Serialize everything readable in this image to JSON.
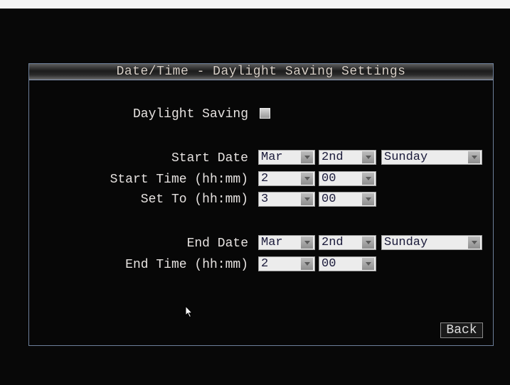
{
  "dialog": {
    "title": "Date/Time - Daylight Saving Settings"
  },
  "daylight_saving": {
    "label": "Daylight Saving",
    "checked": false
  },
  "start": {
    "date_label": "Start Date",
    "month": "Mar",
    "week": "2nd",
    "day": "Sunday",
    "time_label": "Start Time (hh:mm)",
    "hour": "2",
    "minute": "00",
    "setto_label": "Set To (hh:mm)",
    "setto_hour": "3",
    "setto_minute": "00"
  },
  "end": {
    "date_label": "End Date",
    "month": "Mar",
    "week": "2nd",
    "day": "Sunday",
    "time_label": "End Time (hh:mm)",
    "hour": "2",
    "minute": "00"
  },
  "buttons": {
    "back": "Back"
  },
  "icons": {
    "cursor": "mouse-pointer-icon",
    "dropdown": "chevron-down-icon"
  }
}
